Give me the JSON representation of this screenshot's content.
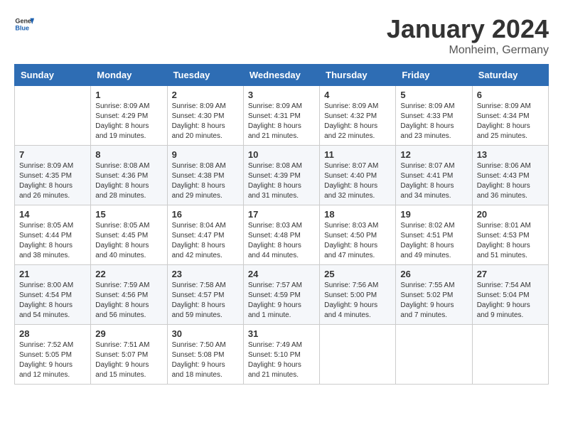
{
  "header": {
    "logo": {
      "general": "General",
      "blue": "Blue"
    },
    "title": "January 2024",
    "subtitle": "Monheim, Germany"
  },
  "calendar": {
    "days_of_week": [
      "Sunday",
      "Monday",
      "Tuesday",
      "Wednesday",
      "Thursday",
      "Friday",
      "Saturday"
    ],
    "weeks": [
      [
        {
          "day": "",
          "sunrise": "",
          "sunset": "",
          "daylight": ""
        },
        {
          "day": "1",
          "sunrise": "Sunrise: 8:09 AM",
          "sunset": "Sunset: 4:29 PM",
          "daylight": "Daylight: 8 hours and 19 minutes."
        },
        {
          "day": "2",
          "sunrise": "Sunrise: 8:09 AM",
          "sunset": "Sunset: 4:30 PM",
          "daylight": "Daylight: 8 hours and 20 minutes."
        },
        {
          "day": "3",
          "sunrise": "Sunrise: 8:09 AM",
          "sunset": "Sunset: 4:31 PM",
          "daylight": "Daylight: 8 hours and 21 minutes."
        },
        {
          "day": "4",
          "sunrise": "Sunrise: 8:09 AM",
          "sunset": "Sunset: 4:32 PM",
          "daylight": "Daylight: 8 hours and 22 minutes."
        },
        {
          "day": "5",
          "sunrise": "Sunrise: 8:09 AM",
          "sunset": "Sunset: 4:33 PM",
          "daylight": "Daylight: 8 hours and 23 minutes."
        },
        {
          "day": "6",
          "sunrise": "Sunrise: 8:09 AM",
          "sunset": "Sunset: 4:34 PM",
          "daylight": "Daylight: 8 hours and 25 minutes."
        }
      ],
      [
        {
          "day": "7",
          "sunrise": "Sunrise: 8:09 AM",
          "sunset": "Sunset: 4:35 PM",
          "daylight": "Daylight: 8 hours and 26 minutes."
        },
        {
          "day": "8",
          "sunrise": "Sunrise: 8:08 AM",
          "sunset": "Sunset: 4:36 PM",
          "daylight": "Daylight: 8 hours and 28 minutes."
        },
        {
          "day": "9",
          "sunrise": "Sunrise: 8:08 AM",
          "sunset": "Sunset: 4:38 PM",
          "daylight": "Daylight: 8 hours and 29 minutes."
        },
        {
          "day": "10",
          "sunrise": "Sunrise: 8:08 AM",
          "sunset": "Sunset: 4:39 PM",
          "daylight": "Daylight: 8 hours and 31 minutes."
        },
        {
          "day": "11",
          "sunrise": "Sunrise: 8:07 AM",
          "sunset": "Sunset: 4:40 PM",
          "daylight": "Daylight: 8 hours and 32 minutes."
        },
        {
          "day": "12",
          "sunrise": "Sunrise: 8:07 AM",
          "sunset": "Sunset: 4:41 PM",
          "daylight": "Daylight: 8 hours and 34 minutes."
        },
        {
          "day": "13",
          "sunrise": "Sunrise: 8:06 AM",
          "sunset": "Sunset: 4:43 PM",
          "daylight": "Daylight: 8 hours and 36 minutes."
        }
      ],
      [
        {
          "day": "14",
          "sunrise": "Sunrise: 8:05 AM",
          "sunset": "Sunset: 4:44 PM",
          "daylight": "Daylight: 8 hours and 38 minutes."
        },
        {
          "day": "15",
          "sunrise": "Sunrise: 8:05 AM",
          "sunset": "Sunset: 4:45 PM",
          "daylight": "Daylight: 8 hours and 40 minutes."
        },
        {
          "day": "16",
          "sunrise": "Sunrise: 8:04 AM",
          "sunset": "Sunset: 4:47 PM",
          "daylight": "Daylight: 8 hours and 42 minutes."
        },
        {
          "day": "17",
          "sunrise": "Sunrise: 8:03 AM",
          "sunset": "Sunset: 4:48 PM",
          "daylight": "Daylight: 8 hours and 44 minutes."
        },
        {
          "day": "18",
          "sunrise": "Sunrise: 8:03 AM",
          "sunset": "Sunset: 4:50 PM",
          "daylight": "Daylight: 8 hours and 47 minutes."
        },
        {
          "day": "19",
          "sunrise": "Sunrise: 8:02 AM",
          "sunset": "Sunset: 4:51 PM",
          "daylight": "Daylight: 8 hours and 49 minutes."
        },
        {
          "day": "20",
          "sunrise": "Sunrise: 8:01 AM",
          "sunset": "Sunset: 4:53 PM",
          "daylight": "Daylight: 8 hours and 51 minutes."
        }
      ],
      [
        {
          "day": "21",
          "sunrise": "Sunrise: 8:00 AM",
          "sunset": "Sunset: 4:54 PM",
          "daylight": "Daylight: 8 hours and 54 minutes."
        },
        {
          "day": "22",
          "sunrise": "Sunrise: 7:59 AM",
          "sunset": "Sunset: 4:56 PM",
          "daylight": "Daylight: 8 hours and 56 minutes."
        },
        {
          "day": "23",
          "sunrise": "Sunrise: 7:58 AM",
          "sunset": "Sunset: 4:57 PM",
          "daylight": "Daylight: 8 hours and 59 minutes."
        },
        {
          "day": "24",
          "sunrise": "Sunrise: 7:57 AM",
          "sunset": "Sunset: 4:59 PM",
          "daylight": "Daylight: 9 hours and 1 minute."
        },
        {
          "day": "25",
          "sunrise": "Sunrise: 7:56 AM",
          "sunset": "Sunset: 5:00 PM",
          "daylight": "Daylight: 9 hours and 4 minutes."
        },
        {
          "day": "26",
          "sunrise": "Sunrise: 7:55 AM",
          "sunset": "Sunset: 5:02 PM",
          "daylight": "Daylight: 9 hours and 7 minutes."
        },
        {
          "day": "27",
          "sunrise": "Sunrise: 7:54 AM",
          "sunset": "Sunset: 5:04 PM",
          "daylight": "Daylight: 9 hours and 9 minutes."
        }
      ],
      [
        {
          "day": "28",
          "sunrise": "Sunrise: 7:52 AM",
          "sunset": "Sunset: 5:05 PM",
          "daylight": "Daylight: 9 hours and 12 minutes."
        },
        {
          "day": "29",
          "sunrise": "Sunrise: 7:51 AM",
          "sunset": "Sunset: 5:07 PM",
          "daylight": "Daylight: 9 hours and 15 minutes."
        },
        {
          "day": "30",
          "sunrise": "Sunrise: 7:50 AM",
          "sunset": "Sunset: 5:08 PM",
          "daylight": "Daylight: 9 hours and 18 minutes."
        },
        {
          "day": "31",
          "sunrise": "Sunrise: 7:49 AM",
          "sunset": "Sunset: 5:10 PM",
          "daylight": "Daylight: 9 hours and 21 minutes."
        },
        {
          "day": "",
          "sunrise": "",
          "sunset": "",
          "daylight": ""
        },
        {
          "day": "",
          "sunrise": "",
          "sunset": "",
          "daylight": ""
        },
        {
          "day": "",
          "sunrise": "",
          "sunset": "",
          "daylight": ""
        }
      ]
    ]
  }
}
